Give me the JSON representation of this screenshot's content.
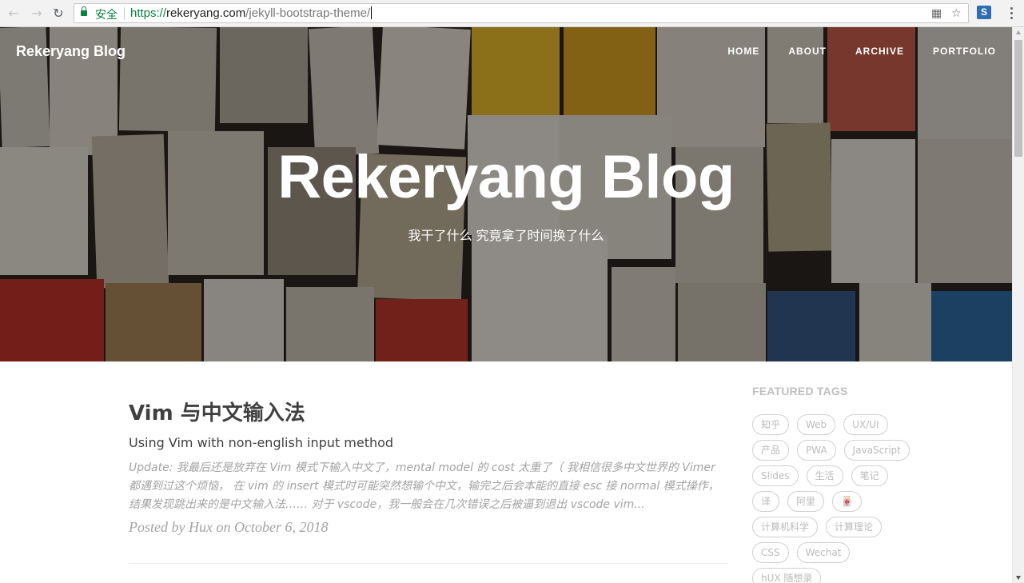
{
  "browser": {
    "secure_label": "安全",
    "url_scheme": "https://",
    "url_domain": "rekeryang.com",
    "url_path": "/jekyll-bootstrap-theme/"
  },
  "site": {
    "brand": "Rekeryang Blog",
    "nav": [
      "HOME",
      "ABOUT",
      "ARCHIVE",
      "PORTFOLIO"
    ],
    "hero_title": "Rekeryang Blog",
    "hero_subtitle": "我干了什么 究竟拿了时间换了什么"
  },
  "post": {
    "title": "Vim 与中文输入法",
    "subtitle": "Using Vim with non-english input method",
    "excerpt": "Update: 我最后还是放弃在 Vim 模式下输入中文了，mental model 的 cost 太重了（ 我相信很多中文世界的 Vimer 都遇到过这个烦恼， 在 vim 的 insert 模式时可能突然想输个中文，输完之后会本能的直接 esc 接 normal 模式操作，结果发现跳出来的是中文输入法…… 对于 vscode，我一般会在几次错误之后被逼到退出 vscode vim...",
    "meta": "Posted by Hux on October 6, 2018"
  },
  "sidebar": {
    "heading": "FEATURED TAGS",
    "tags": [
      "知乎",
      "Web",
      "UX/UI",
      "产品",
      "PWA",
      "JavaScript",
      "Slides",
      "生活",
      "笔记",
      "译",
      "阿里",
      "🀄",
      "计算机科学",
      "计算理论",
      "CSS",
      "Wechat",
      "hUX 随想录"
    ]
  },
  "colors": {
    "secure_green": "#0b8043",
    "title_text": "#404040",
    "muted_text": "#a3a3a3",
    "tag_border": "#d0d0d0"
  }
}
